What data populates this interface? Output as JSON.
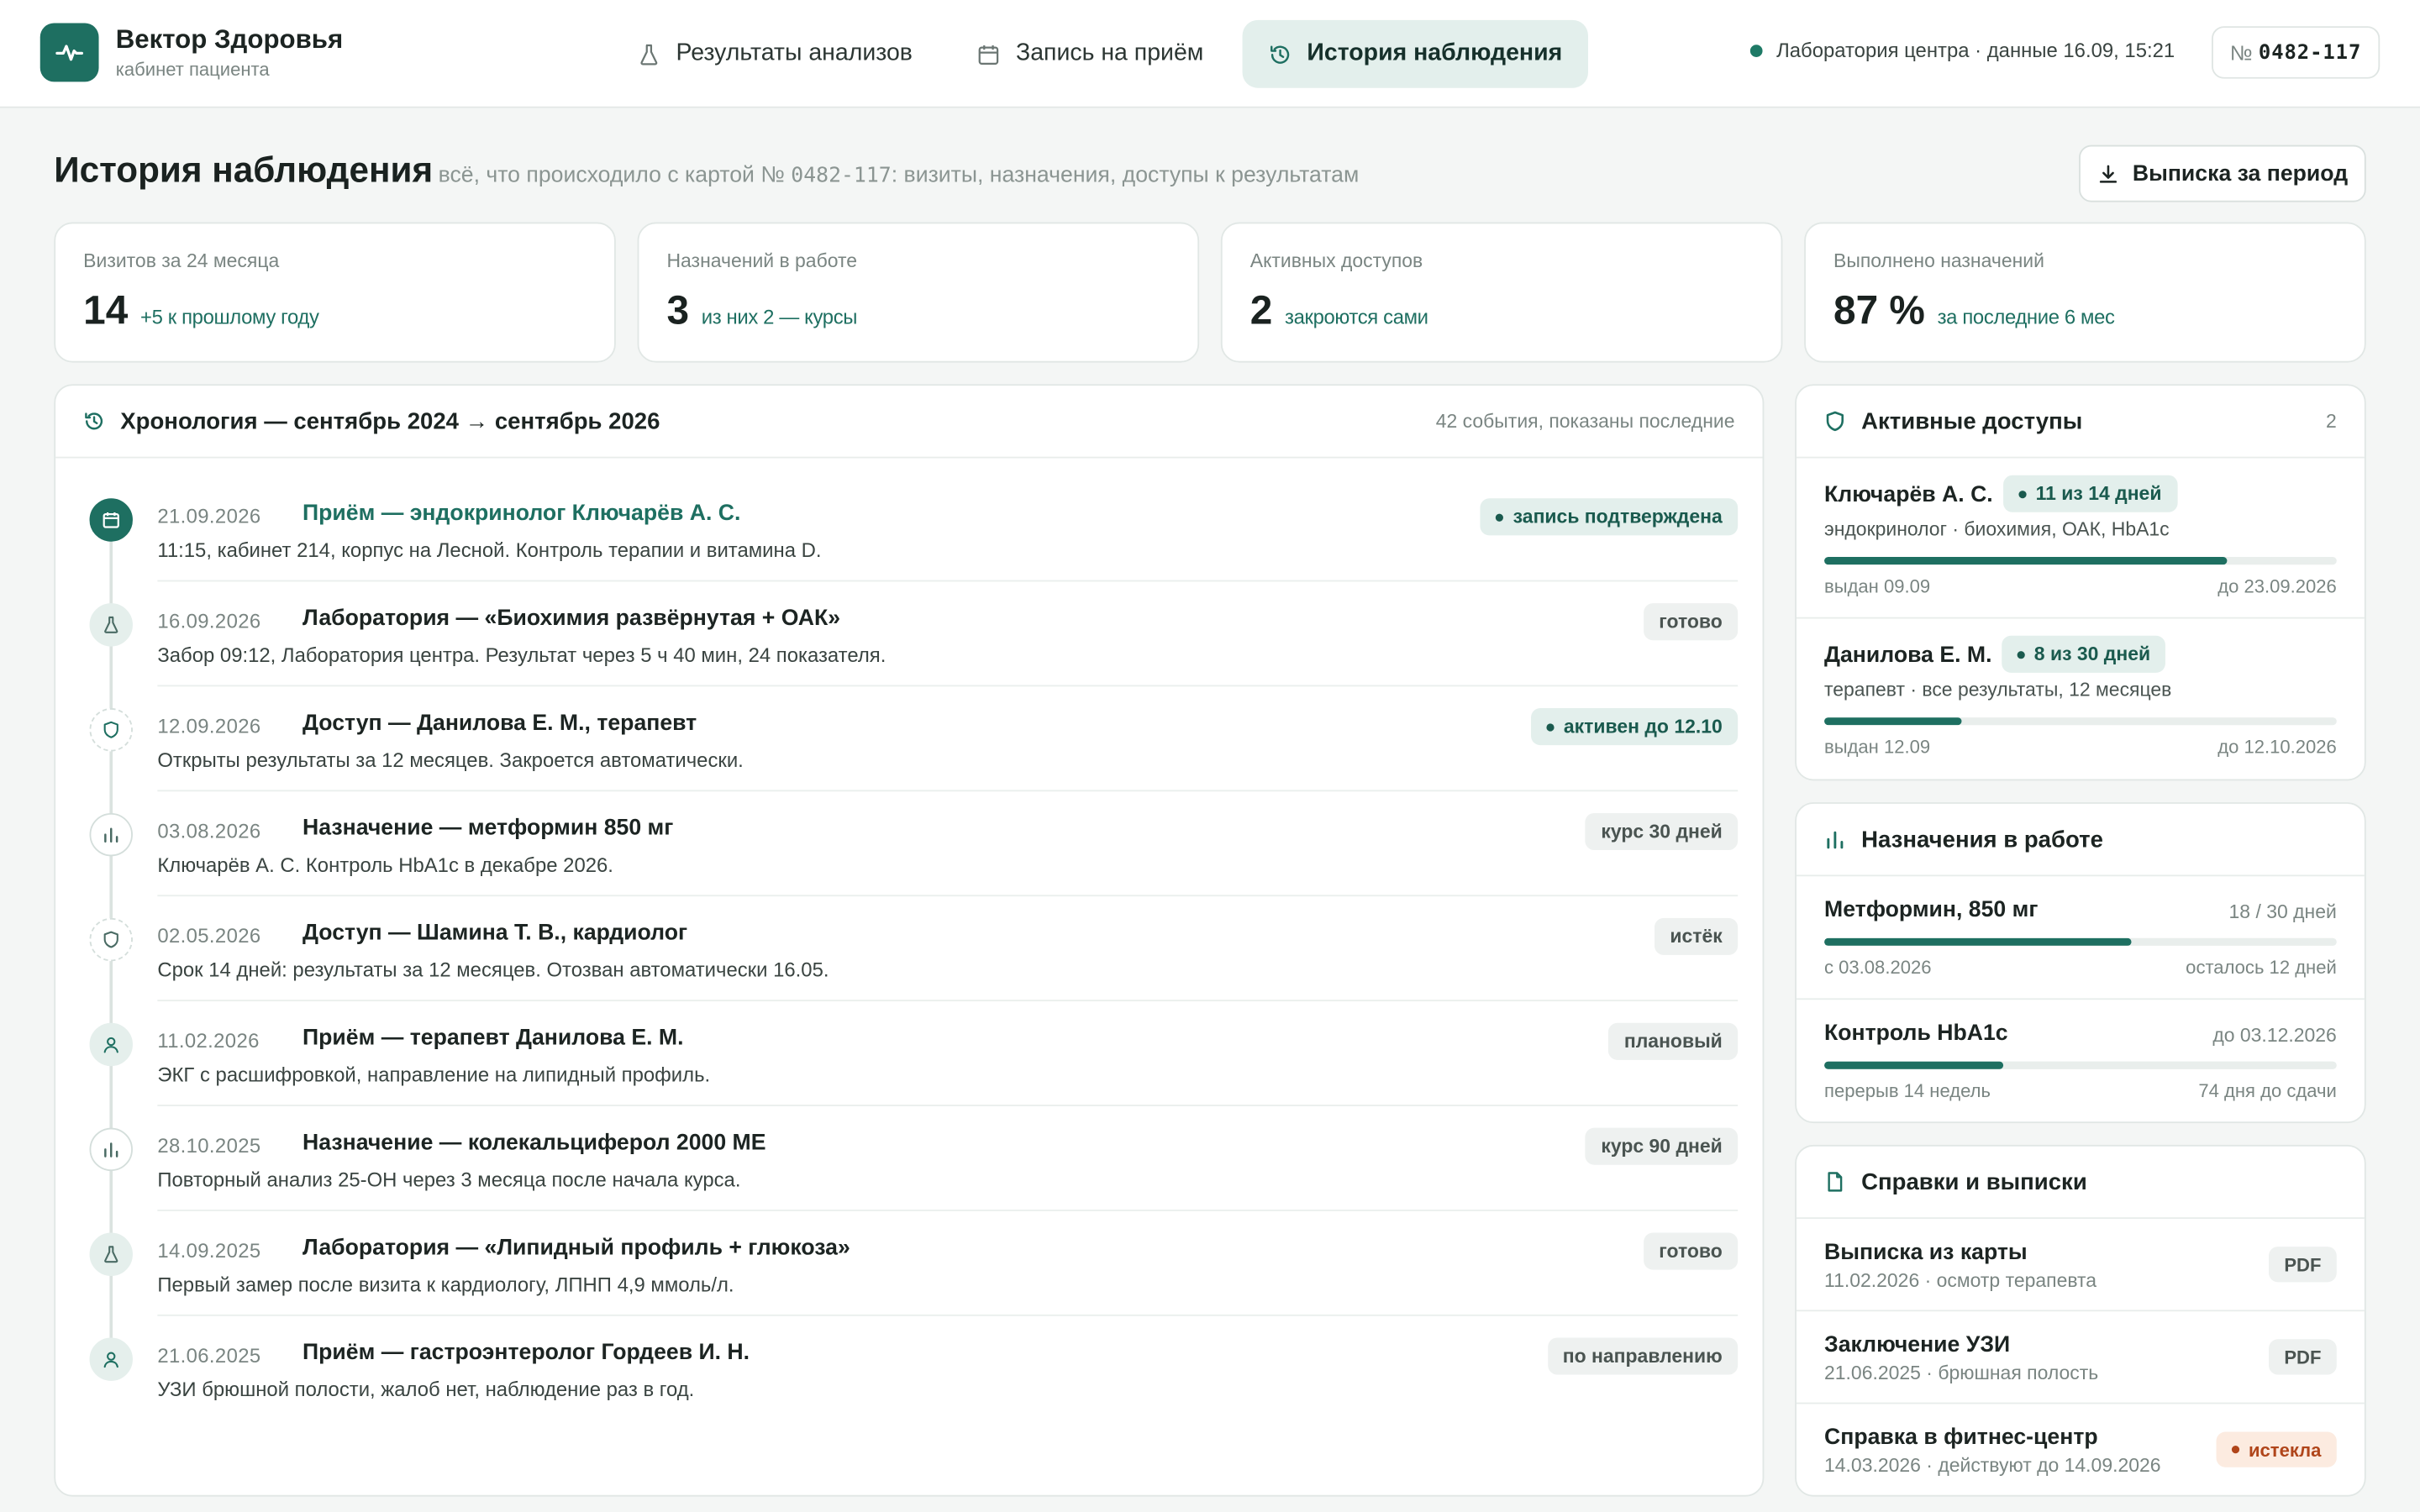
{
  "brand": {
    "name": "Вектор Здоровья",
    "subtitle": "кабинет пациента"
  },
  "nav": {
    "tabs": [
      {
        "label": "Результаты анализов",
        "icon": "flask-icon",
        "active": false
      },
      {
        "label": "Запись на приём",
        "icon": "calendar-icon",
        "active": false
      },
      {
        "label": "История наблюдения",
        "icon": "history-icon",
        "active": true
      }
    ]
  },
  "status": {
    "text": "Лаборатория центра · данные 16.09, 15:21",
    "color": "#1e7a66"
  },
  "card": {
    "prefix": "№",
    "number": "0482-117"
  },
  "header": {
    "title": "История наблюдения",
    "subtitle_before": "всё, что происходило с картой № ",
    "subtitle_mono": "0482-117",
    "subtitle_after": ": визиты, назначения, доступы к результатам",
    "export_label": "Выписка за период"
  },
  "stats": [
    {
      "label": "Визитов за 24 месяца",
      "value": "14",
      "note": "+5 к прошлому году"
    },
    {
      "label": "Назначений в работе",
      "value": "3",
      "note": "из них 2 — курсы"
    },
    {
      "label": "Активных доступов",
      "value": "2",
      "note": "закроются сами"
    },
    {
      "label": "Выполнено назначений",
      "value": "87 %",
      "note": "за последние 6 мес"
    }
  ],
  "timeline": {
    "title": "Хронология — сентябрь 2024 → сентябрь 2026",
    "aside": "42 события, показаны последние",
    "events": [
      {
        "date": "21.09.2026",
        "title": "Приём — эндокринолог Ключарёв А. С.",
        "desc": "11:15, кабинет 214, корпус на Лесной. Контроль терапии и витамина D.",
        "badge": "запись подтверждена",
        "icon": "calendar-icon"
      },
      {
        "date": "16.09.2026",
        "title": "Лаборатория — «Биохимия развёрнутая + ОАК»",
        "desc": "Забор 09:12, Лаборатория центра. Результат через 5 ч 40 мин, 24 показателя.",
        "badge": "готово",
        "icon": "flask-icon"
      },
      {
        "date": "12.09.2026",
        "title": "Доступ — Данилова Е. М., терапевт",
        "desc": "Открыты результаты за 12 месяцев. Закроется автоматически.",
        "badge": "активен до 12.10",
        "icon": "shield-icon"
      },
      {
        "date": "03.08.2026",
        "title": "Назначение — метформин 850 мг",
        "desc": "Ключарёв А. С. Контроль HbA1c в декабре 2026.",
        "badge": "курс 30 дней",
        "icon": "chart-icon"
      },
      {
        "date": "02.05.2026",
        "title": "Доступ — Шамина Т. В., кардиолог",
        "desc": "Срок 14 дней: результаты за 12 месяцев. Отозван автоматически 16.05.",
        "badge": "истёк",
        "icon": "shield-icon"
      },
      {
        "date": "11.02.2026",
        "title": "Приём — терапевт Данилова Е. М.",
        "desc": "ЭКГ с расшифровкой, направление на липидный профиль.",
        "badge": "плановый",
        "icon": "person-icon"
      },
      {
        "date": "28.10.2025",
        "title": "Назначение — колекальциферол 2000 МЕ",
        "desc": "Повторный анализ 25-ОН через 3 месяца после начала курса.",
        "badge": "курс 90 дней",
        "icon": "chart-icon"
      },
      {
        "date": "14.09.2025",
        "title": "Лаборатория — «Липидный профиль + глюкоза»",
        "desc": "Первый замер после визита к кардиологу, ЛПНП 4,9 ммоль/л.",
        "badge": "готово",
        "icon": "flask-icon"
      },
      {
        "date": "21.06.2025",
        "title": "Приём — гастроэнтеролог Гордеев И. Н.",
        "desc": "УЗИ брюшной полости, жалоб нет, наблюдение раз в год.",
        "badge": "по направлению",
        "icon": "person-icon"
      }
    ]
  },
  "access": {
    "title": "Активные доступы",
    "count": "2",
    "items": [
      {
        "name": "Ключарёв А. С.",
        "badge": "11 из 14 дней",
        "sub": "эндокринолог · биохимия, ОАК, HbA1c",
        "progress": 0.786,
        "from": "выдан 09.09",
        "to": "до 23.09.2026"
      },
      {
        "name": "Данилова Е. М.",
        "badge": "8 из 30 дней",
        "sub": "терапевт · все результаты, 12 месяцев",
        "progress": 0.267,
        "from": "выдан 12.09",
        "to": "до 12.10.2026"
      }
    ]
  },
  "prescriptions": {
    "title": "Назначения в работе",
    "items": [
      {
        "name": "Метформин, 850 мг",
        "right": "18 / 30 дней",
        "progress": 0.6,
        "from": "с 03.08.2026",
        "to": "осталось 12 дней"
      },
      {
        "name": "Контроль HbA1c",
        "right": "до 03.12.2026",
        "progress": 0.35,
        "from": "перерыв 14 недель",
        "to": "74 дня до сдачи"
      }
    ]
  },
  "documents": {
    "title": "Справки и выписки",
    "items": [
      {
        "name": "Выписка из карты",
        "sub": "11.02.2026 · осмотр терапевта",
        "badge": "PDF"
      },
      {
        "name": "Заключение УЗИ",
        "sub": "21.06.2025 · брюшная полость",
        "badge": "PDF"
      },
      {
        "name": "Справка в фитнес-центр",
        "sub": "14.03.2026 · действуют до 14.09.2026",
        "badge": "истекла"
      }
    ]
  },
  "colors": {
    "accent": "#1e6f61",
    "accent_soft": "#e3efec",
    "warning": "#b0451a",
    "warning_soft": "#fcebe0"
  }
}
